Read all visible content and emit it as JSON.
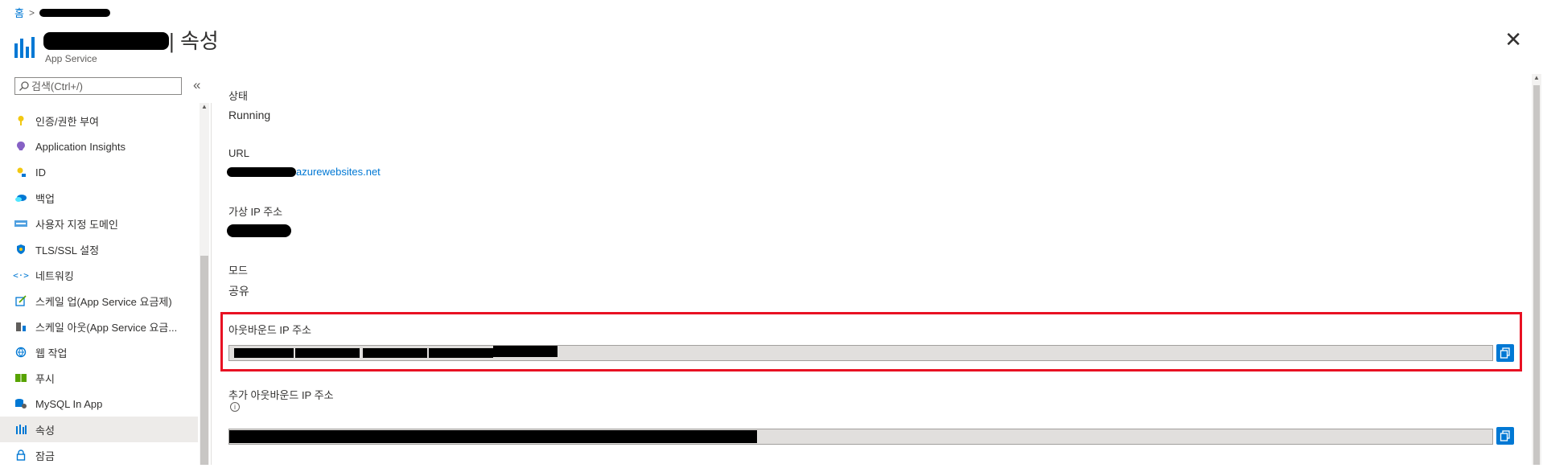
{
  "breadcrumb": {
    "home": "홈"
  },
  "header": {
    "title_suffix": "| 속성",
    "subtitle": "App Service",
    "close": "✕"
  },
  "search": {
    "placeholder": "검색(Ctrl+/)"
  },
  "sidebar": {
    "collapse": "«",
    "items": [
      {
        "label": "인증/권한 부여",
        "icon": "key-icon"
      },
      {
        "label": "Application Insights",
        "icon": "app-insights-icon"
      },
      {
        "label": "ID",
        "icon": "identity-icon"
      },
      {
        "label": "백업",
        "icon": "backup-icon"
      },
      {
        "label": "사용자 지정 도메인",
        "icon": "custom-domain-icon"
      },
      {
        "label": "TLS/SSL 설정",
        "icon": "shield-icon"
      },
      {
        "label": "네트워킹",
        "icon": "networking-icon"
      },
      {
        "label": "스케일 업(App Service 요금제)",
        "icon": "scale-up-icon"
      },
      {
        "label": "스케일 아웃(App Service 요금...",
        "icon": "scale-out-icon"
      },
      {
        "label": "웹 작업",
        "icon": "webjobs-icon"
      },
      {
        "label": "푸시",
        "icon": "push-icon"
      },
      {
        "label": "MySQL In App",
        "icon": "mysql-icon"
      },
      {
        "label": "속성",
        "icon": "properties-icon",
        "active": true
      },
      {
        "label": "잠금",
        "icon": "lock-icon"
      }
    ]
  },
  "properties": {
    "status_label": "상태",
    "status_value": "Running",
    "url_label": "URL",
    "url_suffix": "azurewebsites.net",
    "vip_label": "가상 IP 주소",
    "mode_label": "모드",
    "mode_value": "공유",
    "outbound_label": "아웃바운드 IP 주소",
    "additional_outbound_label": "추가 아웃바운드 IP 주소",
    "info_glyph": "i"
  },
  "colors": {
    "accent": "#0078d4",
    "highlight": "#e81123",
    "active_bg": "#edebe9"
  }
}
